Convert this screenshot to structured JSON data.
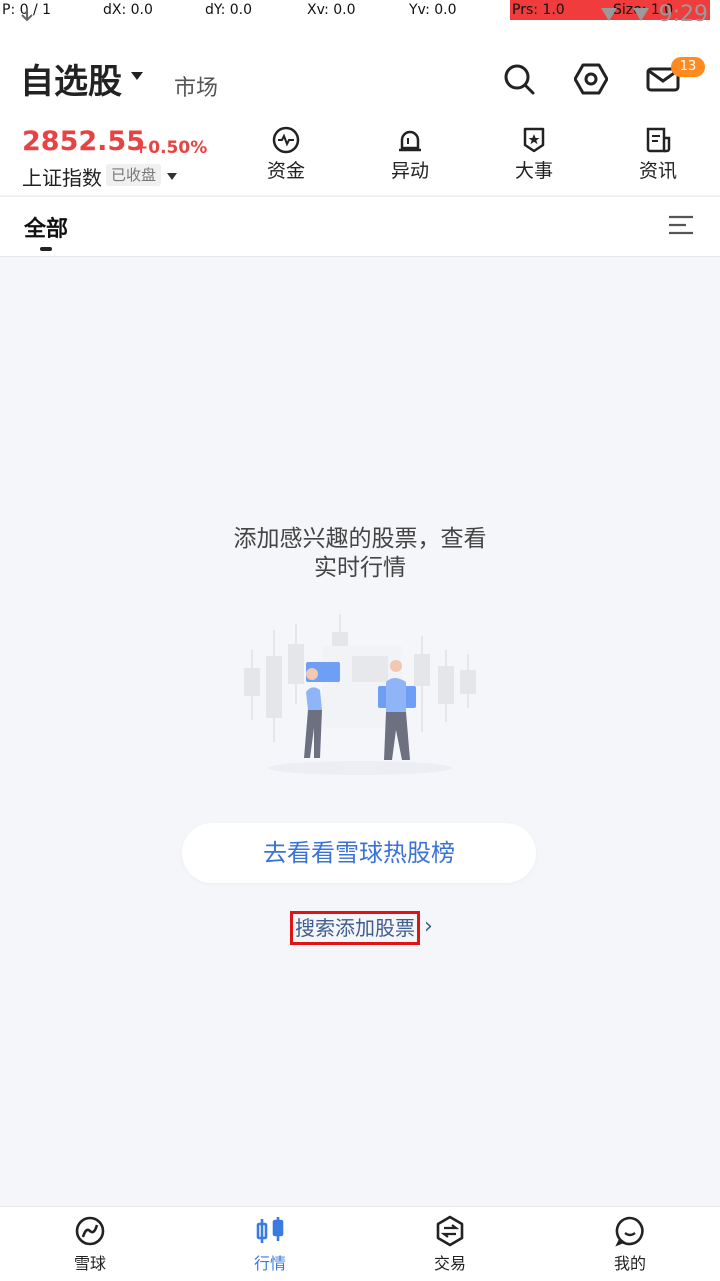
{
  "status_bar": {
    "p": "P: 0 / 1",
    "dx": "dX: 0.0",
    "dy": "dY: 0.0",
    "xv": "Xv: 0.0",
    "yv": "Yv: 0.0",
    "prs": "Prs: 1.0",
    "size": "Size: 1.0",
    "time": "9:29"
  },
  "header": {
    "title": "自选股",
    "market_tab": "市场",
    "mail_badge": "13"
  },
  "index": {
    "value": "2852.55",
    "change": "+0.50%",
    "name": "上证指数",
    "status": "已收盘"
  },
  "quick_links": [
    {
      "label": "资金",
      "icon": "pulse-icon"
    },
    {
      "label": "异动",
      "icon": "alarm-icon"
    },
    {
      "label": "大事",
      "icon": "star-shield-icon"
    },
    {
      "label": "资讯",
      "icon": "news-icon"
    }
  ],
  "tabs": {
    "active": "全部"
  },
  "empty_state": {
    "line1": "添加感兴趣的股票，查看",
    "line2": "实时行情",
    "primary_button": "去看看雪球热股榜",
    "secondary_link": "搜索添加股票"
  },
  "bottom_nav": [
    {
      "label": "雪球",
      "icon": "snowball-icon",
      "active": false
    },
    {
      "label": "行情",
      "icon": "candlestick-icon",
      "active": true
    },
    {
      "label": "交易",
      "icon": "trade-icon",
      "active": false
    },
    {
      "label": "我的",
      "icon": "profile-icon",
      "active": false
    }
  ],
  "colors": {
    "up_red": "#e84343",
    "accent_blue": "#3a7be0",
    "badge_orange": "#ff8a1f"
  }
}
